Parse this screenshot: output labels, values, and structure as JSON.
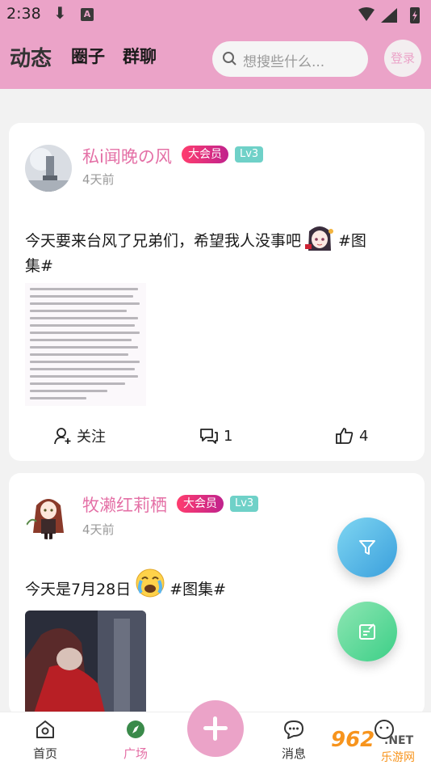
{
  "status_bar": {
    "time": "2:38",
    "notification_letter": "A"
  },
  "header": {
    "tabs": [
      {
        "label": "动态",
        "active": true
      },
      {
        "label": "圈子",
        "active": false
      },
      {
        "label": "群聊",
        "active": false
      }
    ],
    "search_placeholder": "想搜些什么...",
    "login_label": "登录"
  },
  "posts": [
    {
      "username": "私i闻晚の风",
      "vip_badge": "大会员",
      "level_badge": "Lv3",
      "time": "4天前",
      "text_line1": "今天要来台风了兄弟们，希望我人没事吧",
      "text_tag_inline": "#图",
      "text_line2": "集#",
      "follow_label": "关注",
      "comment_count": "1",
      "like_count": "4"
    },
    {
      "username": "牧濑红莉栖",
      "vip_badge": "大会员",
      "level_badge": "Lv3",
      "time": "4天前",
      "text_before_emoji": "今天是7月28日",
      "text_after_emoji": "#图集#"
    }
  ],
  "bottom_nav": [
    {
      "label": "首页",
      "icon": "home-icon"
    },
    {
      "label": "广场",
      "icon": "compass-icon",
      "active": true
    },
    {
      "label": "消息",
      "icon": "message-icon"
    },
    {
      "label": "",
      "icon": "profile-icon"
    }
  ],
  "watermark": {
    "number": "962",
    "suffix": ".NET",
    "site": "乐游网"
  },
  "colors": {
    "brand_pink": "#eba3c8",
    "username_pink": "#e470a6",
    "level_teal": "#6fd1c8"
  }
}
